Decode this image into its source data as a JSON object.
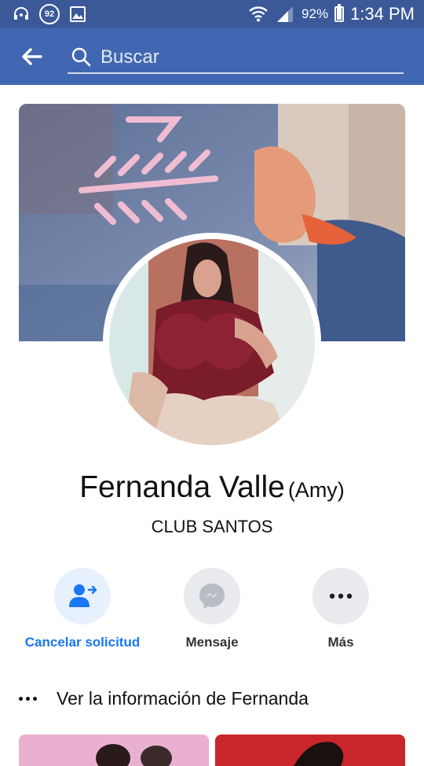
{
  "status_bar": {
    "notification_count": "92",
    "battery_text": "92%",
    "battery_level": 0.92,
    "time": "1:34 PM"
  },
  "search": {
    "placeholder": "Buscar"
  },
  "profile": {
    "name": "Fernanda Valle",
    "alternate_name": "(Amy)",
    "bio": "CLUB SANTOS"
  },
  "actions": [
    {
      "label": "Cancelar solicitud",
      "icon": "cancel-request-icon"
    },
    {
      "label": "Mensaje",
      "icon": "messenger-icon"
    },
    {
      "label": "Más",
      "icon": "more-icon"
    }
  ],
  "info_row": {
    "label": "Ver la información de Fernanda"
  },
  "colors": {
    "status_bar": "#3b5998",
    "app_bar": "#4267b2",
    "primary_accent": "#1877f2"
  }
}
